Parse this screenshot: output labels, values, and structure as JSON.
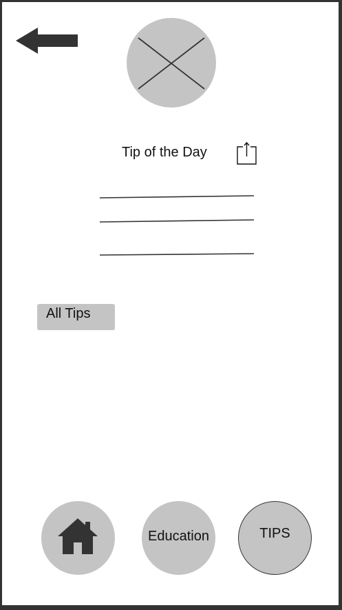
{
  "header": {
    "back_icon": "arrow-left-icon",
    "image_icon": "image-placeholder-icon"
  },
  "tip_of_the_day": {
    "title": "Tip of the Day",
    "share_icon": "share-icon"
  },
  "all_tips_label": "All Tips",
  "bottom_nav": {
    "home_icon": "home-icon",
    "education_label": "Education",
    "tips_label": "TIPS"
  },
  "colors": {
    "frame": "#333333",
    "placeholder_gray": "#c4c4c4",
    "icon_dark": "#333333",
    "background": "#ffffff"
  }
}
